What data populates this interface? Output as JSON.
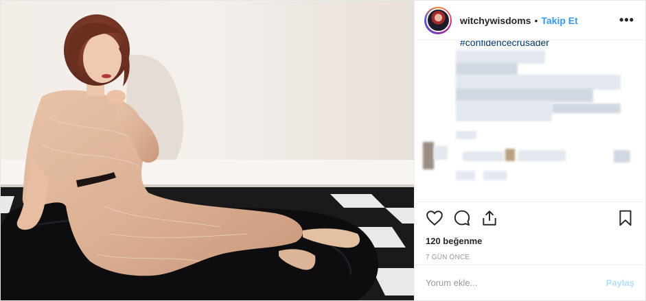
{
  "post": {
    "username": "witchywisdoms",
    "separator": "•",
    "follow_label": "Takip Et",
    "more_label": "•••",
    "hashtag": "#confidencecrusader",
    "likes": "120 beğenme",
    "time": "7 GÜN ÖNCE",
    "comment_placeholder": "Yorum ekle...",
    "post_label": "Paylaş"
  },
  "icons": {
    "like": "heart-icon",
    "comment": "comment-bubble-icon",
    "share": "share-icon",
    "save": "bookmark-icon",
    "more": "more-options-icon"
  },
  "colors": {
    "link_blue": "#3897f0",
    "disabled_blue": "#b2dffc",
    "hashtag": "#003569",
    "muted": "#999999",
    "text": "#262626"
  }
}
